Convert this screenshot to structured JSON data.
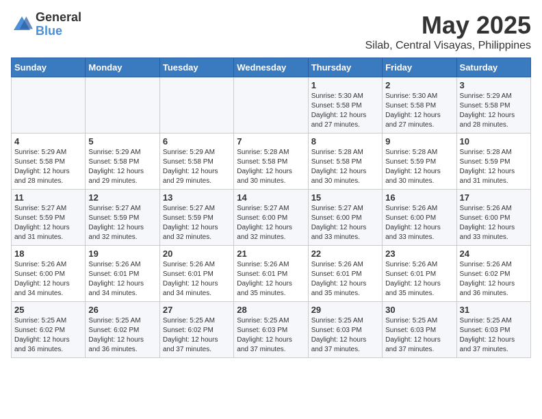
{
  "logo": {
    "general": "General",
    "blue": "Blue"
  },
  "title": "May 2025",
  "subtitle": "Silab, Central Visayas, Philippines",
  "days_header": [
    "Sunday",
    "Monday",
    "Tuesday",
    "Wednesday",
    "Thursday",
    "Friday",
    "Saturday"
  ],
  "weeks": [
    [
      {
        "day": "",
        "info": ""
      },
      {
        "day": "",
        "info": ""
      },
      {
        "day": "",
        "info": ""
      },
      {
        "day": "",
        "info": ""
      },
      {
        "day": "1",
        "info": "Sunrise: 5:30 AM\nSunset: 5:58 PM\nDaylight: 12 hours and 27 minutes."
      },
      {
        "day": "2",
        "info": "Sunrise: 5:30 AM\nSunset: 5:58 PM\nDaylight: 12 hours and 27 minutes."
      },
      {
        "day": "3",
        "info": "Sunrise: 5:29 AM\nSunset: 5:58 PM\nDaylight: 12 hours and 28 minutes."
      }
    ],
    [
      {
        "day": "4",
        "info": "Sunrise: 5:29 AM\nSunset: 5:58 PM\nDaylight: 12 hours and 28 minutes."
      },
      {
        "day": "5",
        "info": "Sunrise: 5:29 AM\nSunset: 5:58 PM\nDaylight: 12 hours and 29 minutes."
      },
      {
        "day": "6",
        "info": "Sunrise: 5:29 AM\nSunset: 5:58 PM\nDaylight: 12 hours and 29 minutes."
      },
      {
        "day": "7",
        "info": "Sunrise: 5:28 AM\nSunset: 5:58 PM\nDaylight: 12 hours and 30 minutes."
      },
      {
        "day": "8",
        "info": "Sunrise: 5:28 AM\nSunset: 5:58 PM\nDaylight: 12 hours and 30 minutes."
      },
      {
        "day": "9",
        "info": "Sunrise: 5:28 AM\nSunset: 5:59 PM\nDaylight: 12 hours and 30 minutes."
      },
      {
        "day": "10",
        "info": "Sunrise: 5:28 AM\nSunset: 5:59 PM\nDaylight: 12 hours and 31 minutes."
      }
    ],
    [
      {
        "day": "11",
        "info": "Sunrise: 5:27 AM\nSunset: 5:59 PM\nDaylight: 12 hours and 31 minutes."
      },
      {
        "day": "12",
        "info": "Sunrise: 5:27 AM\nSunset: 5:59 PM\nDaylight: 12 hours and 32 minutes."
      },
      {
        "day": "13",
        "info": "Sunrise: 5:27 AM\nSunset: 5:59 PM\nDaylight: 12 hours and 32 minutes."
      },
      {
        "day": "14",
        "info": "Sunrise: 5:27 AM\nSunset: 6:00 PM\nDaylight: 12 hours and 32 minutes."
      },
      {
        "day": "15",
        "info": "Sunrise: 5:27 AM\nSunset: 6:00 PM\nDaylight: 12 hours and 33 minutes."
      },
      {
        "day": "16",
        "info": "Sunrise: 5:26 AM\nSunset: 6:00 PM\nDaylight: 12 hours and 33 minutes."
      },
      {
        "day": "17",
        "info": "Sunrise: 5:26 AM\nSunset: 6:00 PM\nDaylight: 12 hours and 33 minutes."
      }
    ],
    [
      {
        "day": "18",
        "info": "Sunrise: 5:26 AM\nSunset: 6:00 PM\nDaylight: 12 hours and 34 minutes."
      },
      {
        "day": "19",
        "info": "Sunrise: 5:26 AM\nSunset: 6:01 PM\nDaylight: 12 hours and 34 minutes."
      },
      {
        "day": "20",
        "info": "Sunrise: 5:26 AM\nSunset: 6:01 PM\nDaylight: 12 hours and 34 minutes."
      },
      {
        "day": "21",
        "info": "Sunrise: 5:26 AM\nSunset: 6:01 PM\nDaylight: 12 hours and 35 minutes."
      },
      {
        "day": "22",
        "info": "Sunrise: 5:26 AM\nSunset: 6:01 PM\nDaylight: 12 hours and 35 minutes."
      },
      {
        "day": "23",
        "info": "Sunrise: 5:26 AM\nSunset: 6:01 PM\nDaylight: 12 hours and 35 minutes."
      },
      {
        "day": "24",
        "info": "Sunrise: 5:26 AM\nSunset: 6:02 PM\nDaylight: 12 hours and 36 minutes."
      }
    ],
    [
      {
        "day": "25",
        "info": "Sunrise: 5:25 AM\nSunset: 6:02 PM\nDaylight: 12 hours and 36 minutes."
      },
      {
        "day": "26",
        "info": "Sunrise: 5:25 AM\nSunset: 6:02 PM\nDaylight: 12 hours and 36 minutes."
      },
      {
        "day": "27",
        "info": "Sunrise: 5:25 AM\nSunset: 6:02 PM\nDaylight: 12 hours and 37 minutes."
      },
      {
        "day": "28",
        "info": "Sunrise: 5:25 AM\nSunset: 6:03 PM\nDaylight: 12 hours and 37 minutes."
      },
      {
        "day": "29",
        "info": "Sunrise: 5:25 AM\nSunset: 6:03 PM\nDaylight: 12 hours and 37 minutes."
      },
      {
        "day": "30",
        "info": "Sunrise: 5:25 AM\nSunset: 6:03 PM\nDaylight: 12 hours and 37 minutes."
      },
      {
        "day": "31",
        "info": "Sunrise: 5:25 AM\nSunset: 6:03 PM\nDaylight: 12 hours and 37 minutes."
      }
    ]
  ]
}
